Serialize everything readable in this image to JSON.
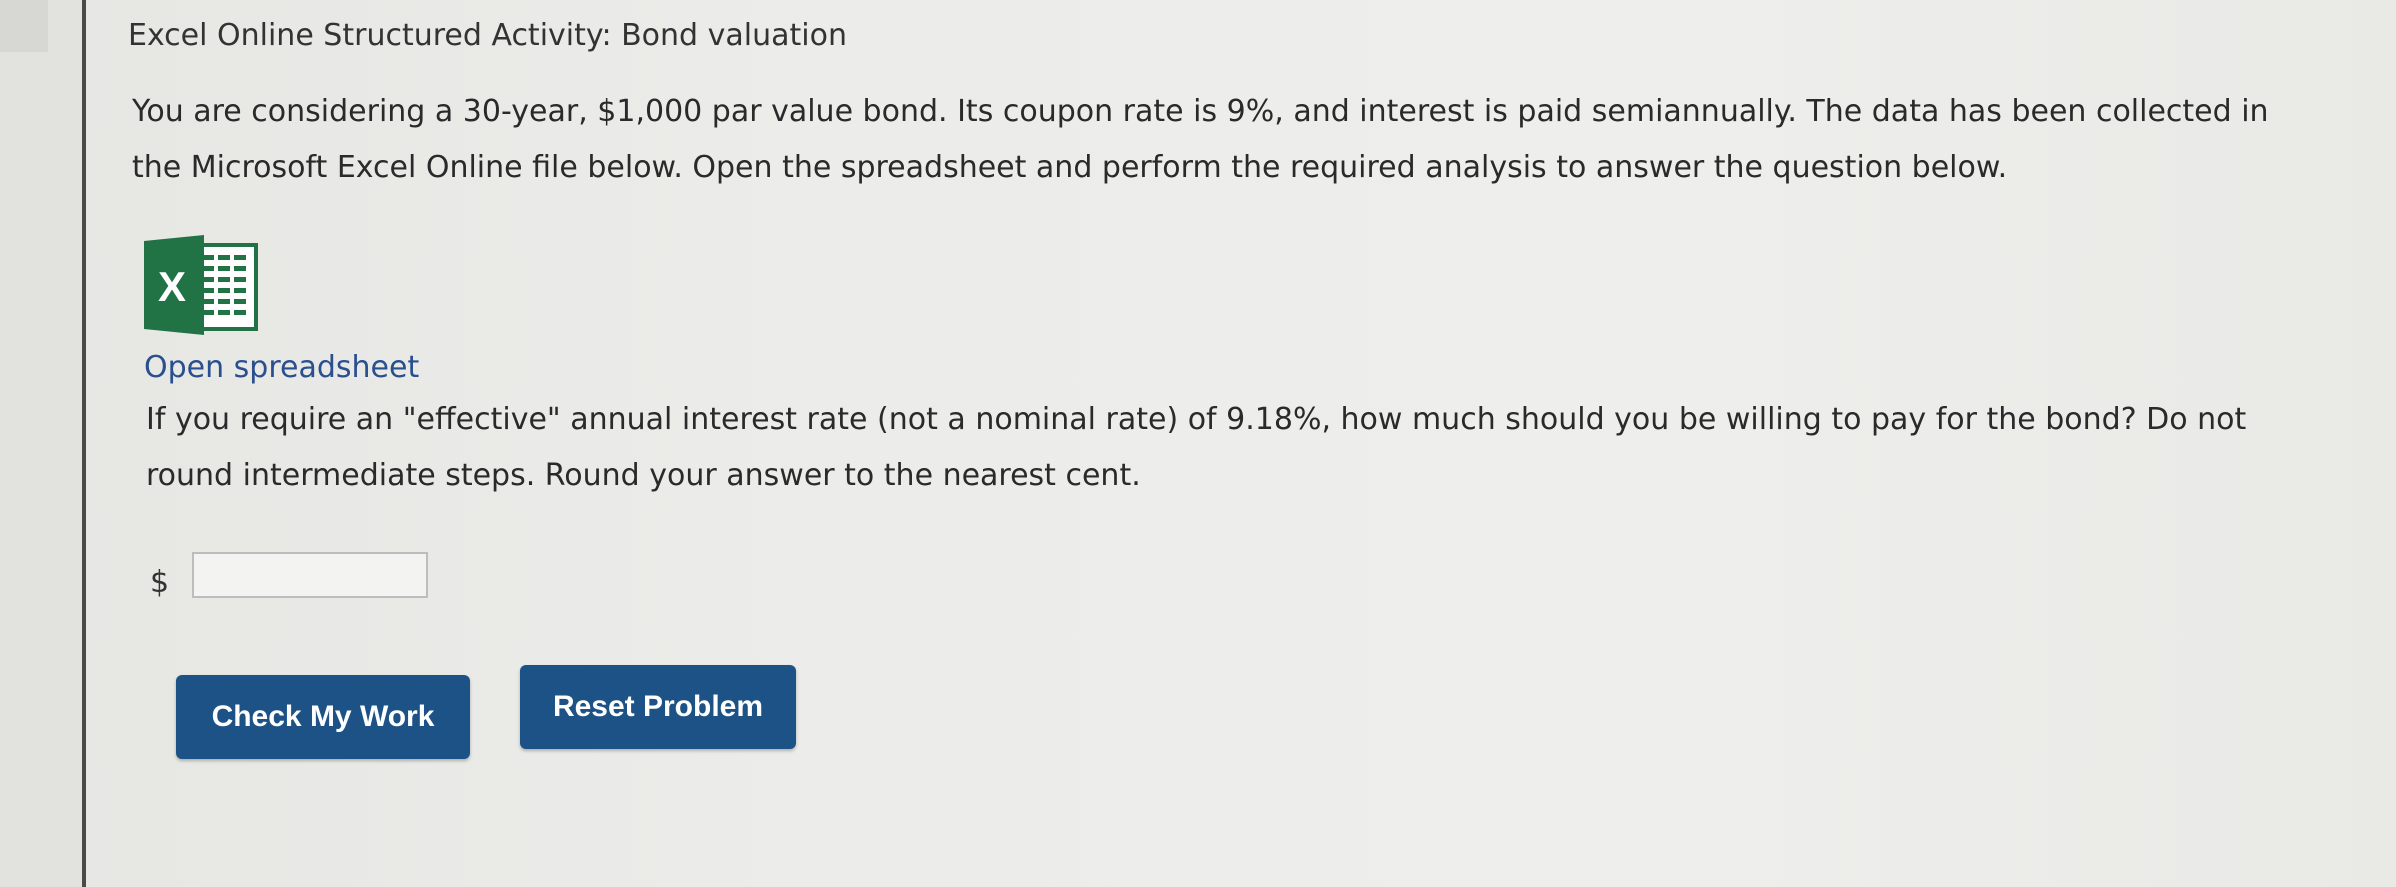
{
  "activity": {
    "title": "Excel Online Structured Activity: Bond valuation"
  },
  "intro": {
    "text": "You are considering a 30-year, $1,000 par value bond. Its coupon rate is 9%, and interest is paid semiannually. The data has been collected in the Microsoft Excel Online file below. Open the spreadsheet and perform the required analysis to answer the question below."
  },
  "spreadsheet": {
    "icon": "excel-icon",
    "icon_letter": "X",
    "link_label": "Open spreadsheet",
    "brand_color": "#217346"
  },
  "question": {
    "text": "If you require an \"effective\" annual interest rate (not a nominal rate) of 9.18%, how much should you be willing to pay for the bond? Do not round intermediate steps. Round your answer to the nearest cent."
  },
  "answer": {
    "currency_symbol": "$",
    "value": ""
  },
  "buttons": {
    "check_label": "Check My Work",
    "reset_label": "Reset Problem",
    "color": "#1d5287"
  }
}
